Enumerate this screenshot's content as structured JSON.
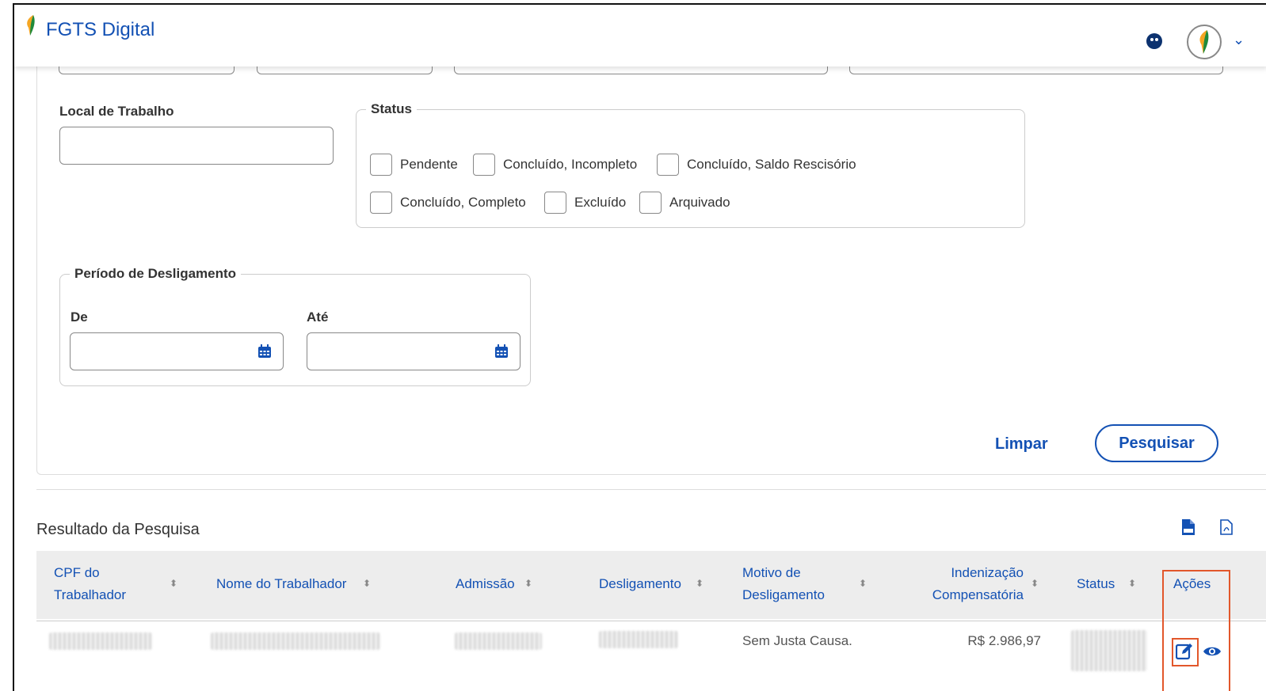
{
  "header": {
    "app_title": "FGTS Digital",
    "icons": [
      "leaf-logo-icon",
      "accessibility-icon",
      "user-avatar-icon",
      "chevron-down-icon"
    ]
  },
  "filters": {
    "local_trabalho": {
      "label": "Local de Trabalho",
      "value": ""
    },
    "status": {
      "legend": "Status",
      "options": [
        {
          "label": "Pendente",
          "checked": false
        },
        {
          "label": "Concluído, Incompleto",
          "checked": false
        },
        {
          "label": "Concluído, Saldo Rescisório",
          "checked": false
        },
        {
          "label": "Concluído, Completo",
          "checked": false
        },
        {
          "label": "Excluído",
          "checked": false
        },
        {
          "label": "Arquivado",
          "checked": false
        }
      ]
    },
    "periodo": {
      "legend": "Período de Desligamento",
      "de_label": "De",
      "ate_label": "Até",
      "de_value": "",
      "ate_value": ""
    },
    "actions": {
      "clear": "Limpar",
      "search": "Pesquisar"
    }
  },
  "results": {
    "title": "Resultado da Pesquisa",
    "export_icons": [
      "csv-file-icon",
      "pdf-file-icon"
    ],
    "columns": {
      "cpf_line1": "CPF do",
      "cpf_line2": "Trabalhador",
      "nome": "Nome do Trabalhador",
      "admissao": "Admissão",
      "desligamento": "Desligamento",
      "motivo_line1": "Motivo de",
      "motivo_line2": "Desligamento",
      "indenizacao_line1": "Indenização",
      "indenizacao_line2": "Compensatória",
      "status": "Status",
      "acoes": "Ações"
    },
    "rows": [
      {
        "motivo": "Sem Justa Causa.",
        "indenizacao": "R$ 2.986,97"
      }
    ]
  },
  "colors": {
    "primary": "#1351b4",
    "highlight": "#e2572b",
    "header_bg": "#ededed"
  }
}
